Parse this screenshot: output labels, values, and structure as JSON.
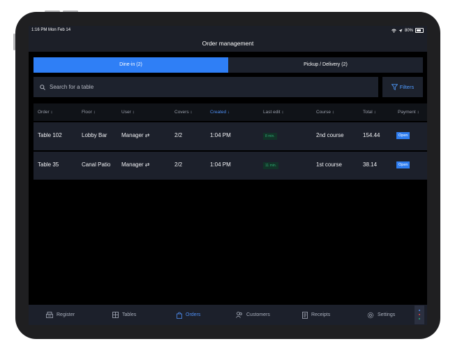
{
  "status_bar": {
    "time": "1:16 PM  Mon Feb 14",
    "battery": "80%"
  },
  "header": {
    "title": "Order management"
  },
  "segments": {
    "dine_in": "Dine-in (2)",
    "pickup_delivery": "Pickup / Delivery (2)"
  },
  "search": {
    "placeholder": "Search for a table",
    "filters_label": "Filters"
  },
  "table": {
    "headers": {
      "order": "Order ↕",
      "floor": "Floor ↕",
      "user": "User ↕",
      "covers": "Covers ↕",
      "created": "Created ↓",
      "last_edit": "Last edit ↕",
      "course": "Course ↕",
      "total": "Total ↕",
      "payment": "Payment ↕"
    },
    "rows": [
      {
        "order": "Table 102",
        "floor": "Lobby Bar",
        "user": "Manager ⇄",
        "covers": "2/2",
        "created": "1:04 PM",
        "last_edit": "8 min.",
        "course": "2nd course",
        "total": "154.44",
        "payment": "Open"
      },
      {
        "order": "Table 35",
        "floor": "Canal Patio",
        "user": "Manager ⇄",
        "covers": "2/2",
        "created": "1:04 PM",
        "last_edit": "11 min.",
        "course": "1st course",
        "total": "38.14",
        "payment": "Open"
      }
    ]
  },
  "tabbar": {
    "register": "Register",
    "tables": "Tables",
    "orders": "Orders",
    "customers": "Customers",
    "receipts": "Receipts",
    "settings": "Settings"
  },
  "colors": {
    "accent": "#2f7ff6",
    "background": "#000000",
    "panel": "#1d222d",
    "badge_green": "#2fa971"
  }
}
